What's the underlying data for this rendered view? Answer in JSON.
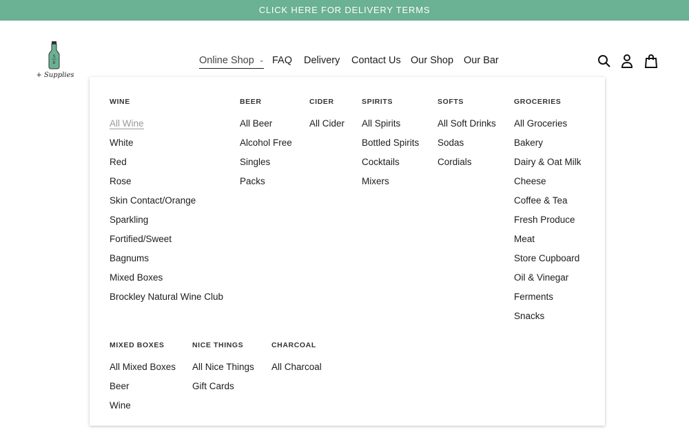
{
  "banner": {
    "text": "CLICK HERE FOR DELIVERY TERMS",
    "color": "#6bb193"
  },
  "logo": {
    "bottle_text": "S/B",
    "text": "+ Supplies"
  },
  "nav": [
    {
      "label": "Online Shop",
      "active": true,
      "has_dropdown": true
    },
    {
      "label": "FAQ"
    },
    {
      "label": "Delivery"
    },
    {
      "label": "Contact Us"
    },
    {
      "label": "Our Shop"
    },
    {
      "label": "Our Bar"
    }
  ],
  "header_icons": [
    "search-icon",
    "account-icon",
    "cart-icon"
  ],
  "menu": {
    "top": [
      {
        "title": "WINE",
        "items": [
          "All Wine",
          "White",
          "Red",
          "Rose",
          "Skin Contact/Orange",
          "Sparkling",
          "Fortified/Sweet",
          "Bagnums",
          "Mixed Boxes",
          "Brockley Natural Wine Club"
        ]
      },
      {
        "title": "BEER",
        "items": [
          "All Beer",
          "Alcohol Free",
          "Singles",
          "Packs"
        ]
      },
      {
        "title": "CIDER",
        "items": [
          "All Cider"
        ]
      },
      {
        "title": "SPIRITS",
        "items": [
          "All Spirits",
          "Bottled Spirits",
          "Cocktails",
          "Mixers"
        ]
      },
      {
        "title": "SOFTS",
        "items": [
          "All Soft Drinks",
          "Sodas",
          "Cordials"
        ]
      },
      {
        "title": "GROCERIES",
        "items": [
          "All Groceries",
          "Bakery",
          "Dairy & Oat Milk",
          "Cheese",
          "Coffee & Tea",
          "Fresh Produce",
          "Meat",
          "Store Cupboard",
          "Oil & Vinegar",
          "Ferments",
          "Snacks"
        ]
      }
    ],
    "bottom": [
      {
        "title": "MIXED BOXES",
        "items": [
          "All Mixed Boxes",
          "Beer",
          "Wine"
        ]
      },
      {
        "title": "NICE THINGS",
        "items": [
          "All Nice Things",
          "Gift Cards"
        ]
      },
      {
        "title": "CHARCOAL",
        "items": [
          "All Charcoal"
        ]
      }
    ],
    "hovered_item": "All Wine"
  }
}
